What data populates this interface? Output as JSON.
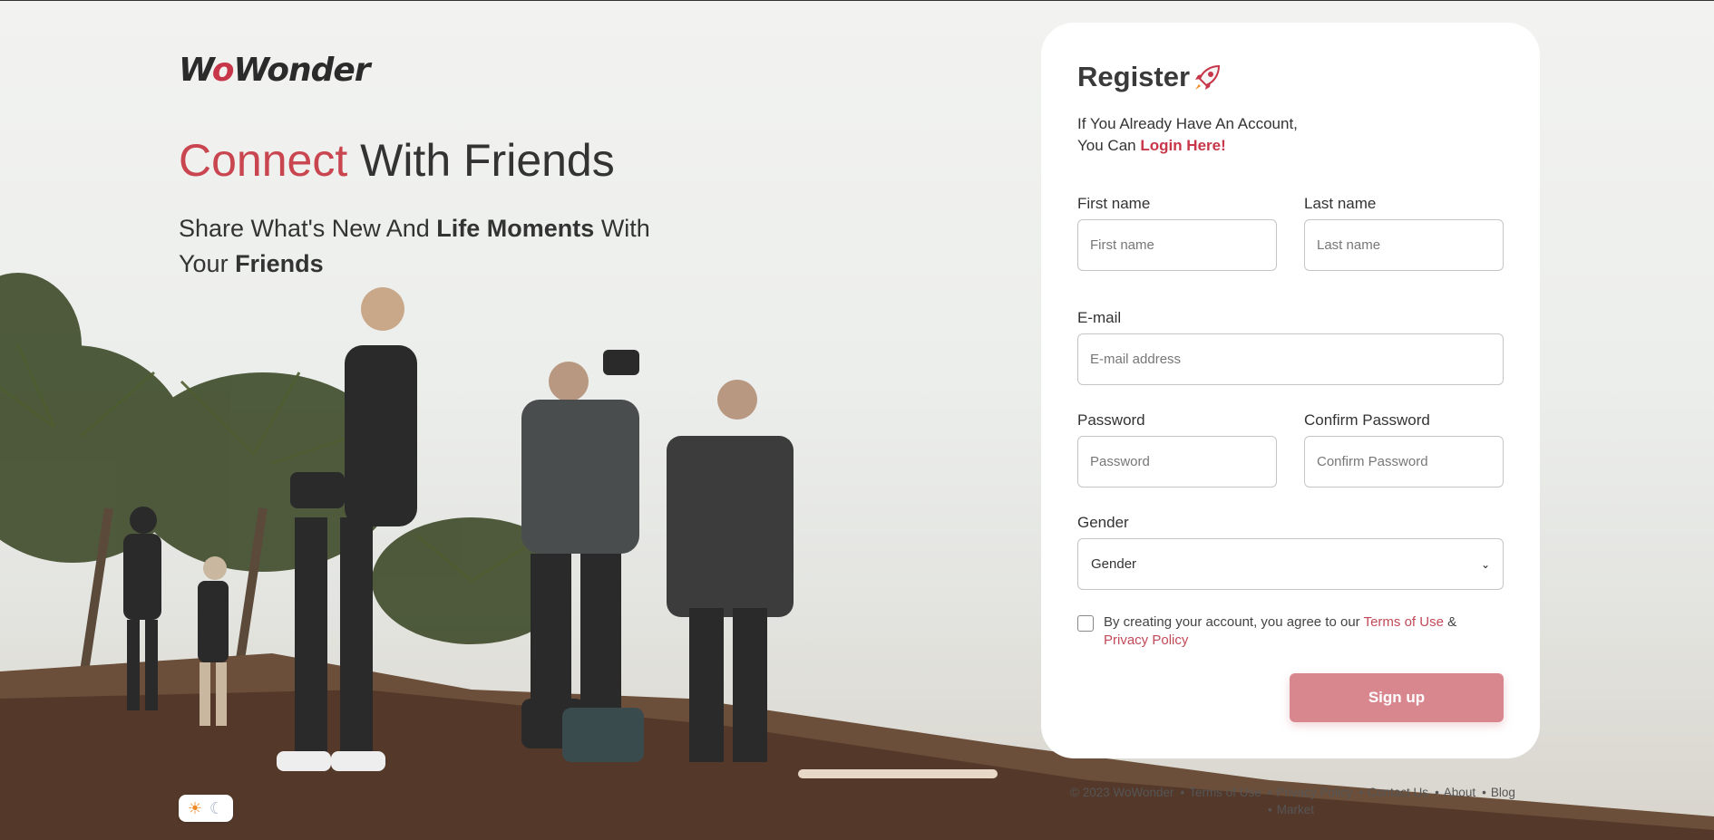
{
  "brand": {
    "logo_text_a": "W",
    "logo_text_o": "o",
    "logo_text_b": "Wonder"
  },
  "hero": {
    "headline_accent": "Connect",
    "headline_rest": " With Friends",
    "sub_part1": "Share What's New And ",
    "sub_bold1": "Life Moments",
    "sub_part2": " With Your ",
    "sub_bold2": "Friends"
  },
  "theme_toggle": {
    "light_icon": "sun-icon",
    "dark_icon": "moon-icon"
  },
  "register": {
    "title": "Register",
    "title_icon": "rocket-icon",
    "account_line1": "If You Already Have An Account,",
    "account_line2": "You Can ",
    "login_link": "Login Here!",
    "first_name_label": "First name",
    "first_name_placeholder": "First name",
    "last_name_label": "Last name",
    "last_name_placeholder": "Last name",
    "email_label": "E-mail",
    "email_placeholder": "E-mail address",
    "password_label": "Password",
    "password_placeholder": "Password",
    "confirm_label": "Confirm Password",
    "confirm_placeholder": "Confirm Password",
    "gender_label": "Gender",
    "gender_selected": "Gender",
    "terms_text": "By creating your account, you agree to our ",
    "terms_link": "Terms of Use",
    "terms_amp": " & ",
    "privacy_link": "Privacy Policy",
    "signup_label": "Sign up"
  },
  "footer": {
    "copyright": "© 2023 WoWonder",
    "links": [
      "Terms of Use",
      "Privacy Policy",
      "Contact Us",
      "About",
      "Blog",
      "Market"
    ]
  },
  "colors": {
    "accent": "#c9454f",
    "signup_button": "#d9878f"
  }
}
